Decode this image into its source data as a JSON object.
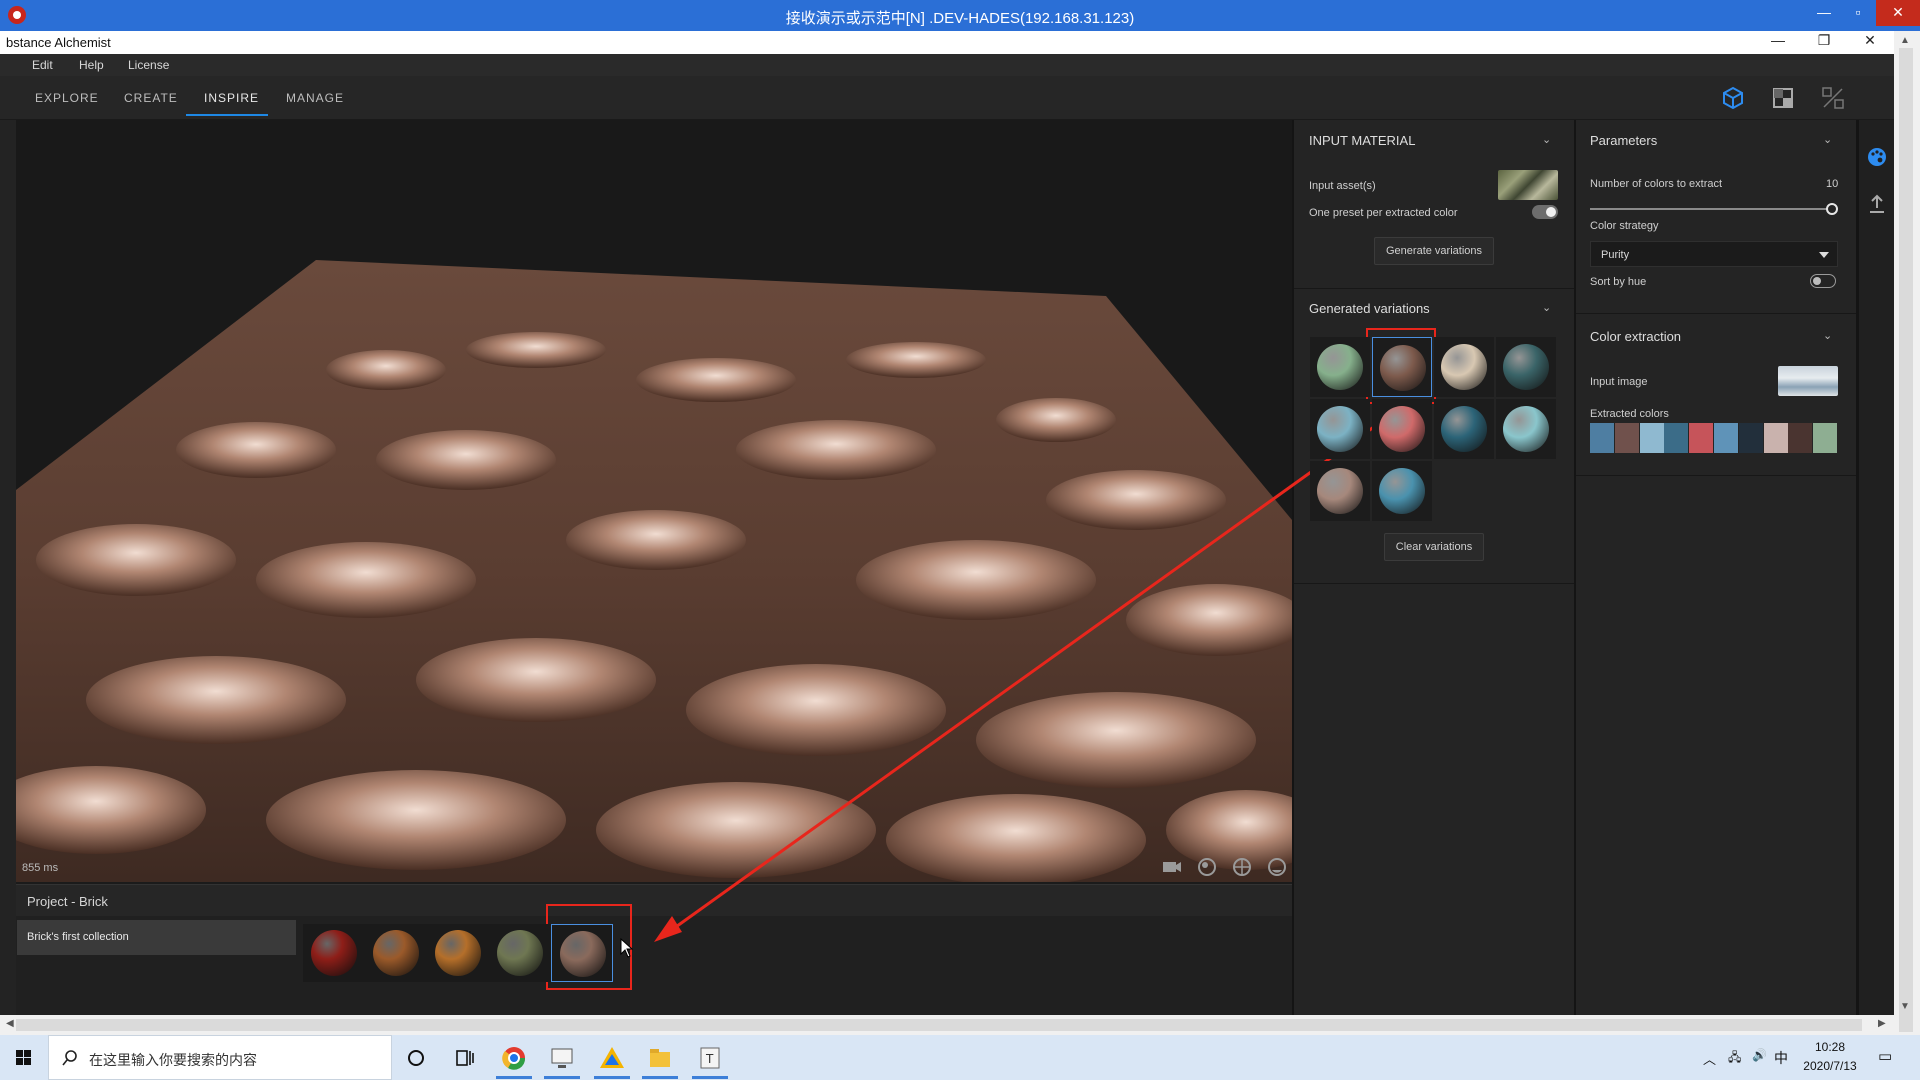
{
  "remote_window": {
    "title": "接收演示或示范中[N] .DEV-HADES(192.168.31.123)"
  },
  "app": {
    "title": "bstance Alchemist"
  },
  "menu": [
    "Edit",
    "Help",
    "License"
  ],
  "tabs": [
    "EXPLORE",
    "CREATE",
    "INSPIRE",
    "MANAGE"
  ],
  "viewport": {
    "render_time": "855 ms"
  },
  "project": {
    "title": "Project - Brick",
    "collection": "Brick's first collection",
    "materials": [
      {
        "color": "#8e1e18"
      },
      {
        "color": "#9b5a2a"
      },
      {
        "color": "#b56f2a"
      },
      {
        "color": "#6f7752"
      },
      {
        "color": "#8a6a5c"
      }
    ]
  },
  "input_material": {
    "header": "INPUT MATERIAL",
    "input_assets_label": "Input asset(s)",
    "one_preset_label": "One preset per extracted color",
    "generate_button": "Generate variations"
  },
  "generated_variations": {
    "header": "Generated variations",
    "clear_button": "Clear variations",
    "items": [
      {
        "color": "#86b08c"
      },
      {
        "color": "#7d5a4c"
      },
      {
        "color": "#d8c8b2"
      },
      {
        "color": "#3a6468"
      },
      {
        "color": "#7cb2c4"
      },
      {
        "color": "#d06a6a"
      },
      {
        "color": "#2c6478"
      },
      {
        "color": "#8ac6cc"
      },
      {
        "color": "#a6887c"
      },
      {
        "color": "#4a92ae"
      }
    ]
  },
  "parameters": {
    "header": "Parameters",
    "num_colors_label": "Number of colors to extract",
    "num_colors_value": "10",
    "color_strategy_label": "Color strategy",
    "color_strategy_value": "Purity",
    "sort_by_hue_label": "Sort by hue"
  },
  "color_extraction": {
    "header": "Color extraction",
    "input_image_label": "Input image",
    "extracted_colors_label": "Extracted colors",
    "swatches": [
      "#4e7ea2",
      "#70514c",
      "#8fb9d0",
      "#3b6c88",
      "#c6545a",
      "#5f93b8",
      "#222f3b",
      "#c9b2ad",
      "#4a3430",
      "#8eae92"
    ]
  },
  "taskbar": {
    "search_placeholder": "在这里输入你要搜索的内容",
    "time": "10:28",
    "date": "2020/7/13",
    "ime": "中"
  }
}
